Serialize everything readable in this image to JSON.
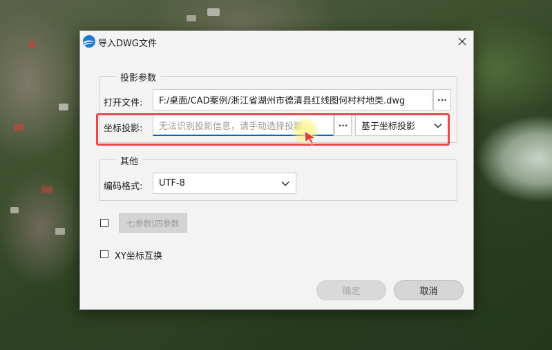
{
  "dialog": {
    "title": "导入DWG文件",
    "close_icon": "close-icon"
  },
  "projection_group": {
    "legend": "投影参数",
    "open_file_label": "打开文件:",
    "open_file_value": "F:/桌面/CAD案例/浙江省湖州市德清县红线图何村村地类.dwg",
    "coord_proj_label": "坐标投影:",
    "coord_proj_placeholder": "无法识别投影信息，请手动选择投影",
    "browse_label": "···",
    "projection_mode": "基于坐标投影"
  },
  "other_group": {
    "legend": "其他",
    "encoding_label": "编码格式:",
    "encoding_value": "UTF-8"
  },
  "seven_param": {
    "checked": false,
    "button_label": "七参数\\四参数"
  },
  "xy_swap": {
    "checked": false,
    "label": "XY坐标互换"
  },
  "footer": {
    "ok_label": "确定",
    "cancel_label": "取消"
  },
  "colors": {
    "highlight": "#e5484d",
    "accent": "#0067c0"
  }
}
